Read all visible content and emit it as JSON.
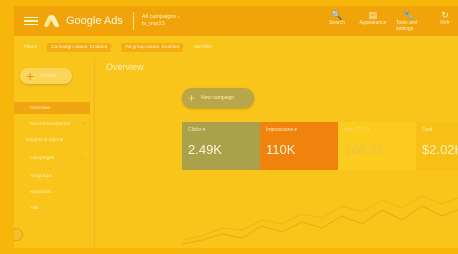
{
  "topbar": {
    "brand": "Google Ads",
    "campaign_line1": "All campaigns ›",
    "campaign_line2": "tv_mar23",
    "tools": [
      {
        "icon": "search-icon",
        "glyph": "🔍",
        "label": "Search"
      },
      {
        "icon": "appearance-icon",
        "glyph": "▤",
        "label": "Appearance"
      },
      {
        "icon": "wrench-icon",
        "glyph": "🔧",
        "label": "Tools and settings"
      },
      {
        "icon": "refresh-icon",
        "glyph": "↻",
        "label": "Refr"
      }
    ]
  },
  "filters": [
    "Filters",
    "Campaign status: Enabled",
    "Ad group status: Enabled",
    "Add filter"
  ],
  "sidebar": {
    "create_label": "Create",
    "items": [
      {
        "label": "Overview",
        "selected": true
      },
      {
        "label": "Recommendations"
      },
      {
        "label": "Insights & reports"
      },
      {
        "label": "Campaigns"
      },
      {
        "label": "Ad groups"
      },
      {
        "label": "Keywords"
      },
      {
        "label": "Ads"
      }
    ]
  },
  "main": {
    "title": "Overview",
    "new_campaign_label": "New campaign",
    "metrics": [
      {
        "label": "Clicks ▾",
        "value": "2.49K"
      },
      {
        "label": "Impressions ▾",
        "value": "110K"
      },
      {
        "label": "Avg. CPC ▾",
        "value": "168.81"
      },
      {
        "label": "Cost",
        "value": "$2.02K"
      }
    ]
  }
}
